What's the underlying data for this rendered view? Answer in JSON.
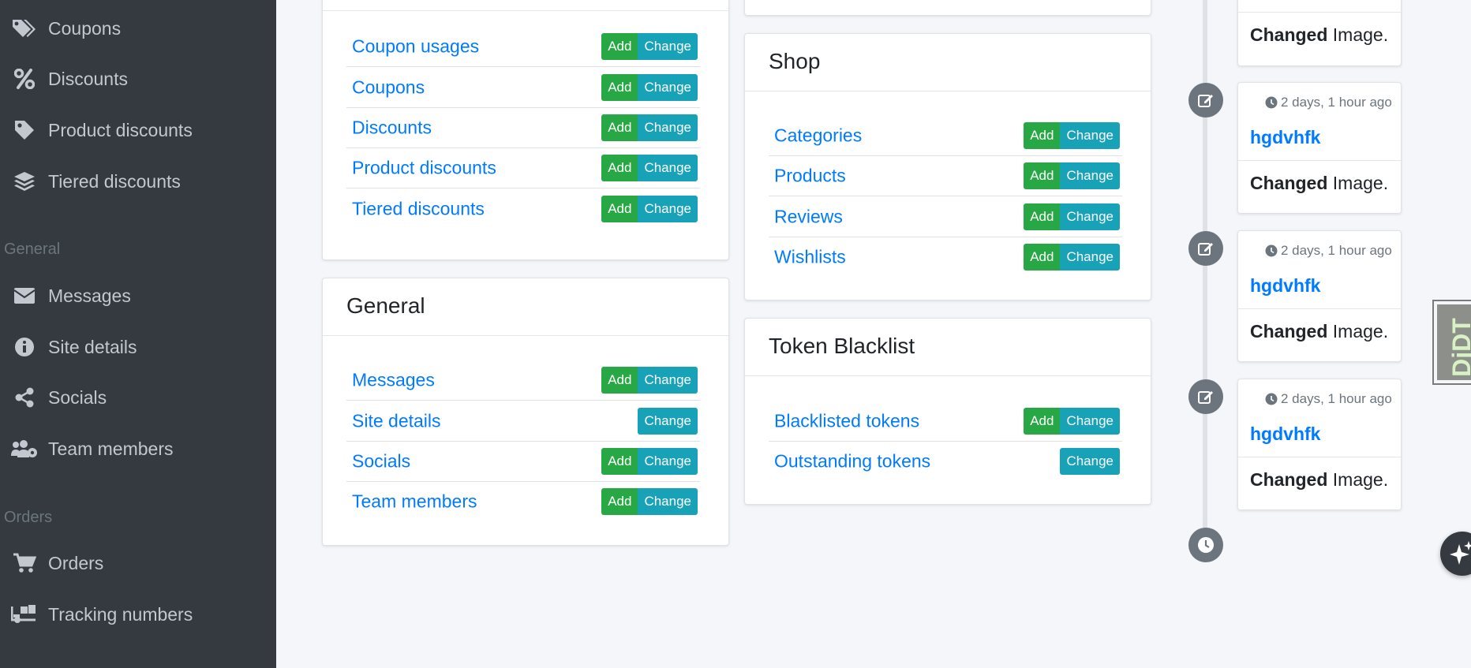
{
  "sidebar": {
    "groups": [
      {
        "items": [
          {
            "label": "Coupons",
            "icon": "tags-icon"
          },
          {
            "label": "Discounts",
            "icon": "percent-icon"
          },
          {
            "label": "Product discounts",
            "icon": "tag-icon"
          },
          {
            "label": "Tiered discounts",
            "icon": "layer-group-icon"
          }
        ]
      },
      {
        "header": "General",
        "items": [
          {
            "label": "Messages",
            "icon": "envelope-icon"
          },
          {
            "label": "Site details",
            "icon": "info-circle-icon"
          },
          {
            "label": "Socials",
            "icon": "share-alt-icon"
          },
          {
            "label": "Team members",
            "icon": "users-cog-icon"
          }
        ]
      },
      {
        "header": "Orders",
        "items": [
          {
            "label": "Orders",
            "icon": "shopping-cart-icon"
          },
          {
            "label": "Tracking numbers",
            "icon": "truck-loading-icon"
          }
        ]
      }
    ]
  },
  "apps": {
    "discounts": {
      "models": [
        {
          "name": "Coupon usages",
          "add": "Add",
          "change": "Change"
        },
        {
          "name": "Coupons",
          "add": "Add",
          "change": "Change"
        },
        {
          "name": "Discounts",
          "add": "Add",
          "change": "Change"
        },
        {
          "name": "Product discounts",
          "add": "Add",
          "change": "Change"
        },
        {
          "name": "Tiered discounts",
          "add": "Add",
          "change": "Change"
        }
      ]
    },
    "general": {
      "title": "General",
      "models": [
        {
          "name": "Messages",
          "add": "Add",
          "change": "Change"
        },
        {
          "name": "Site details",
          "change": "Change"
        },
        {
          "name": "Socials",
          "add": "Add",
          "change": "Change"
        },
        {
          "name": "Team members",
          "add": "Add",
          "change": "Change"
        }
      ]
    },
    "shop": {
      "title": "Shop",
      "models": [
        {
          "name": "Categories",
          "add": "Add",
          "change": "Change"
        },
        {
          "name": "Products",
          "add": "Add",
          "change": "Change"
        },
        {
          "name": "Reviews",
          "add": "Add",
          "change": "Change"
        },
        {
          "name": "Wishlists",
          "add": "Add",
          "change": "Change"
        }
      ]
    },
    "token_blacklist": {
      "title": "Token Blacklist",
      "models": [
        {
          "name": "Blacklisted tokens",
          "add": "Add",
          "change": "Change"
        },
        {
          "name": "Outstanding tokens",
          "change": "Change"
        }
      ]
    }
  },
  "timeline": {
    "top_entry": {
      "action": "Changed",
      "object": "Image."
    },
    "entries": [
      {
        "time": "2 days, 1 hour ago",
        "title": "hgdvhfk",
        "action": "Changed",
        "object": "Image."
      },
      {
        "time": "2 days, 1 hour ago",
        "title": "hgdvhfk",
        "action": "Changed",
        "object": "Image."
      },
      {
        "time": "2 days, 1 hour ago",
        "title": "hgdvhfk",
        "action": "Changed",
        "object": "Image."
      }
    ]
  },
  "djdt": {
    "label": "DjDT"
  },
  "colors": {
    "sidebar_bg": "#343a40",
    "link": "#007bff",
    "add": "#28a745",
    "change": "#17a2b8",
    "page_bg": "#f4f6f9"
  }
}
